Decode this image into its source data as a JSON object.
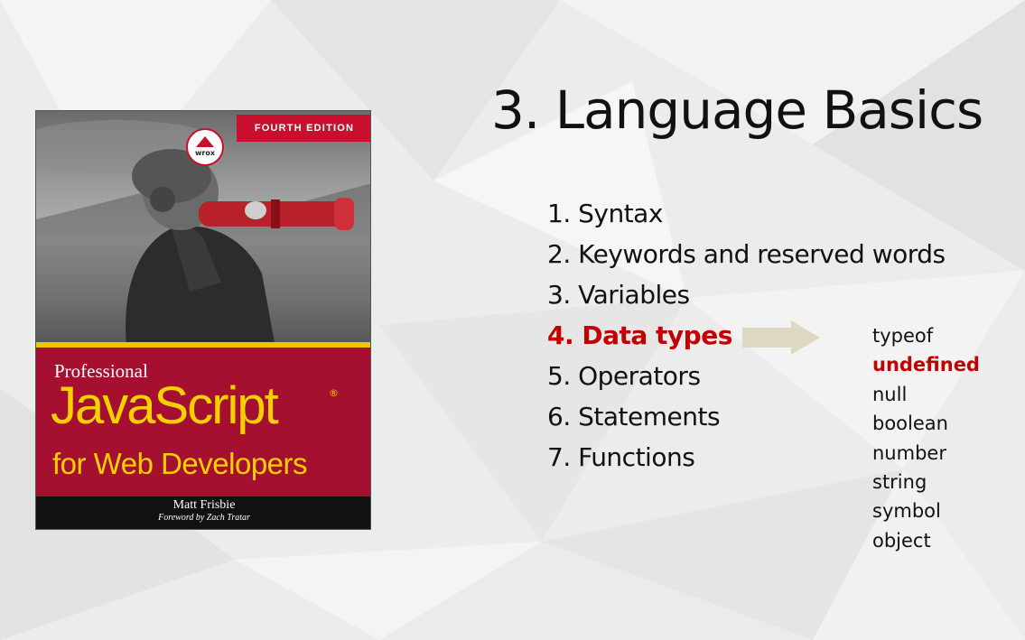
{
  "slide": {
    "title": "3. Language Basics",
    "toc": [
      {
        "label": "1. Syntax"
      },
      {
        "label": "2. Keywords and reserved words"
      },
      {
        "label": "3. Variables"
      },
      {
        "label": "4. Data types",
        "highlighted": true
      },
      {
        "label": "5. Operators"
      },
      {
        "label": "6. Statements"
      },
      {
        "label": "7. Functions"
      }
    ],
    "data_types": [
      {
        "label": "typeof"
      },
      {
        "label": "undefined",
        "highlighted": true
      },
      {
        "label": "null"
      },
      {
        "label": "boolean"
      },
      {
        "label": "number"
      },
      {
        "label": "string"
      },
      {
        "label": "symbol"
      },
      {
        "label": "object"
      }
    ],
    "highlight_color": "#c00000",
    "arrow_color": "#ddd8c4"
  },
  "book": {
    "edition": "FOURTH EDITION",
    "publisher_logo": "wrox",
    "series_text": "Professional",
    "title_line1": "JavaScript",
    "title_line2": "for Web Developers",
    "registered": "®",
    "author": "Matt Frisbie",
    "foreword": "Foreword by Zach Tratar",
    "colors": {
      "red": "#a51030",
      "yellow": "#f5d000",
      "edition_red": "#c8102e"
    }
  }
}
